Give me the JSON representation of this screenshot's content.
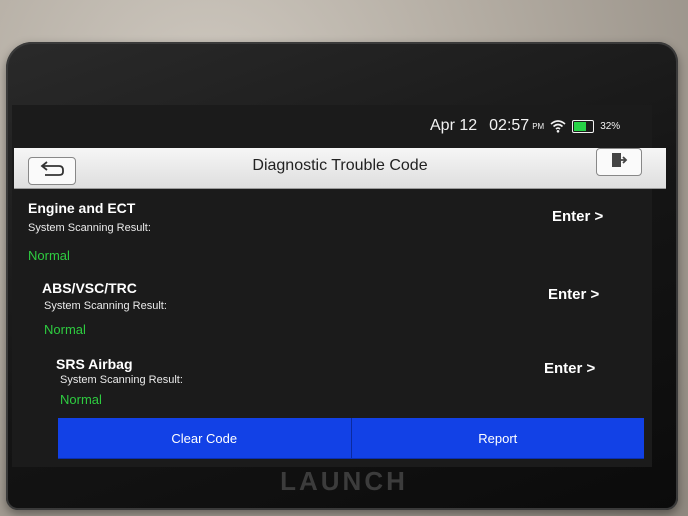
{
  "status": {
    "date": "Apr 12",
    "time": "02:57",
    "ampm": "PM",
    "battery": "32%",
    "wifi_icon": "wifi-icon",
    "battery_icon": "battery-icon",
    "battery_color": "#27d247"
  },
  "header": {
    "title": "Diagnostic Trouble Code",
    "back_icon": "back-arrow-icon",
    "exit_icon": "exit-icon"
  },
  "systems": [
    {
      "name": "Engine and ECT",
      "subtitle": "System Scanning Result:",
      "status": "Normal",
      "enter": "Enter >"
    },
    {
      "name": "ABS/VSC/TRC",
      "subtitle": "System Scanning Result:",
      "status": "Normal",
      "enter": "Enter >"
    },
    {
      "name": "SRS Airbag",
      "subtitle": "System Scanning Result:",
      "status": "Normal",
      "enter": "Enter >"
    }
  ],
  "buttons": {
    "clear_code": "Clear Code",
    "report": "Report"
  },
  "brand": "LAUNCH",
  "colors": {
    "accent": "#1241e6",
    "status_normal": "#2ecc40"
  }
}
